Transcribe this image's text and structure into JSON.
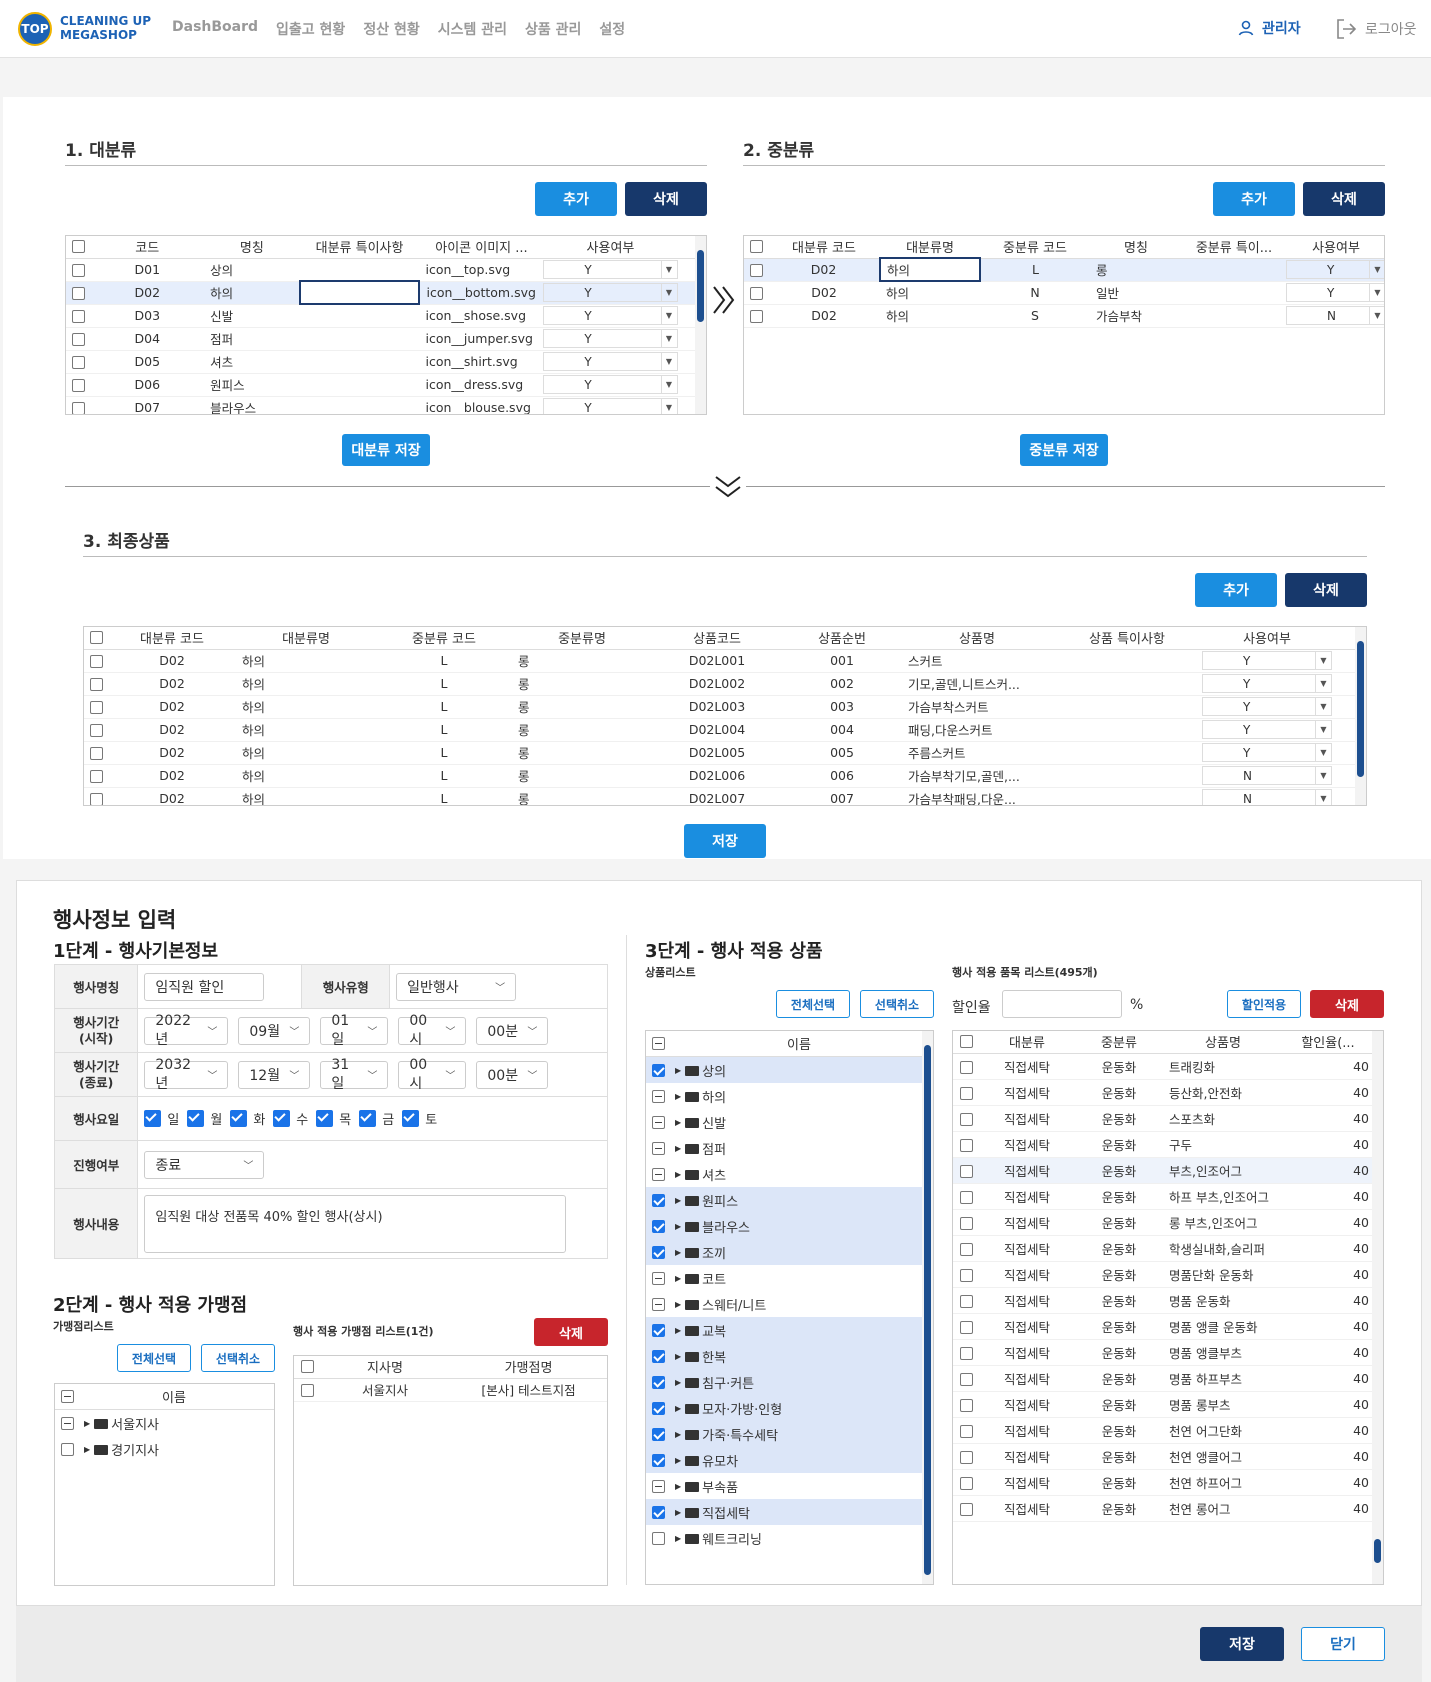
{
  "brand": {
    "logo": "TOP",
    "line1": "CLEANING UP",
    "line2": "MEGASHOP"
  },
  "nav": [
    "DashBoard",
    "입출고 현황",
    "정산 현황",
    "시스템 관리",
    "상품 관리",
    "설정"
  ],
  "user": {
    "name": "관리자",
    "logout": "로그아웃"
  },
  "buttons": {
    "add": "추가",
    "delete": "삭제",
    "save_major": "대분류 저장",
    "save_mid": "중분류 저장",
    "save": "저장",
    "close": "닫기",
    "select_all": "전체선택",
    "deselect": "선택취소",
    "apply_discount": "할인적용"
  },
  "major": {
    "title": "1. 대분류",
    "headers": [
      "코드",
      "명칭",
      "대분류 특이사항",
      "아이콘 이미지 ...",
      "사용여부"
    ],
    "rows": [
      {
        "code": "D01",
        "name": "상의",
        "icon": "icon__top.svg",
        "use": "Y"
      },
      {
        "code": "D02",
        "name": "하의",
        "icon": "icon__bottom.svg",
        "use": "Y"
      },
      {
        "code": "D03",
        "name": "신발",
        "icon": "icon__shose.svg",
        "use": "Y"
      },
      {
        "code": "D04",
        "name": "점퍼",
        "icon": "icon__jumper.svg",
        "use": "Y"
      },
      {
        "code": "D05",
        "name": "셔츠",
        "icon": "icon__shirt.svg",
        "use": "Y"
      },
      {
        "code": "D06",
        "name": "원피스",
        "icon": "icon__dress.svg",
        "use": "Y"
      },
      {
        "code": "D07",
        "name": "블라우스",
        "icon": "icon__blouse.svg",
        "use": "Y"
      }
    ]
  },
  "mid": {
    "title": "2. 중분류",
    "headers": [
      "대분류 코드",
      "대분류명",
      "중분류 코드",
      "명칭",
      "중분류 특이...",
      "사용여부"
    ],
    "rows": [
      {
        "mcode": "D02",
        "mname": "하의",
        "code": "L",
        "name": "롱",
        "use": "Y"
      },
      {
        "mcode": "D02",
        "mname": "하의",
        "code": "N",
        "name": "일반",
        "use": "Y"
      },
      {
        "mcode": "D02",
        "mname": "하의",
        "code": "S",
        "name": "가슴부착",
        "use": "N"
      }
    ]
  },
  "final": {
    "title": "3. 최종상품",
    "headers": [
      "대분류 코드",
      "대분류명",
      "중분류 코드",
      "중분류명",
      "상품코드",
      "상품순번",
      "상품명",
      "상품 특이사항",
      "사용여부"
    ],
    "rows": [
      {
        "mc": "D02",
        "mn": "하의",
        "sc": "L",
        "sn": "롱",
        "pc": "D02L001",
        "seq": "001",
        "pn": "스커트",
        "use": "Y"
      },
      {
        "mc": "D02",
        "mn": "하의",
        "sc": "L",
        "sn": "롱",
        "pc": "D02L002",
        "seq": "002",
        "pn": "기모,골덴,니트스커...",
        "use": "Y"
      },
      {
        "mc": "D02",
        "mn": "하의",
        "sc": "L",
        "sn": "롱",
        "pc": "D02L003",
        "seq": "003",
        "pn": "가슴부착스커트",
        "use": "Y"
      },
      {
        "mc": "D02",
        "mn": "하의",
        "sc": "L",
        "sn": "롱",
        "pc": "D02L004",
        "seq": "004",
        "pn": "패딩,다운스커트",
        "use": "Y"
      },
      {
        "mc": "D02",
        "mn": "하의",
        "sc": "L",
        "sn": "롱",
        "pc": "D02L005",
        "seq": "005",
        "pn": "주름스커트",
        "use": "Y"
      },
      {
        "mc": "D02",
        "mn": "하의",
        "sc": "L",
        "sn": "롱",
        "pc": "D02L006",
        "seq": "006",
        "pn": "가슴부착기모,골덴,...",
        "use": "N"
      },
      {
        "mc": "D02",
        "mn": "하의",
        "sc": "L",
        "sn": "롱",
        "pc": "D02L007",
        "seq": "007",
        "pn": "가슴부착패딩,다운...",
        "use": "N"
      }
    ]
  },
  "event": {
    "title": "행사정보 입력",
    "step1": "1단계 - 행사기본정보",
    "labels": {
      "name": "행사명칭",
      "type": "행사유형",
      "start": "행사기간\n(시작)",
      "end": "행사기간\n(종료)",
      "days": "행사요일",
      "status": "진행여부",
      "content": "행사내용"
    },
    "name_value": "임직원 할인",
    "type_value": "일반행사",
    "start": [
      "2022년",
      "09월",
      "01일",
      "00시",
      "00분"
    ],
    "end": [
      "2032년",
      "12월",
      "31일",
      "00시",
      "00분"
    ],
    "days": [
      "일",
      "월",
      "화",
      "수",
      "목",
      "금",
      "토"
    ],
    "status_value": "종료",
    "content_value": "임직원 대상 전품목 40% 할인 행사(상시)",
    "step2": "2단계 - 행사 적용 가맹점",
    "store_list_label": "가맹점리스트",
    "applied_store_label": "행사 적용 가맹점 리스트(1건)",
    "tree_header": "이름",
    "branches": [
      "서울지사",
      "경기지사"
    ],
    "store_headers": [
      "지사명",
      "가맹점명"
    ],
    "stores": [
      {
        "branch": "서울지사",
        "store": "[본사] 테스트지점"
      }
    ],
    "step3": "3단계 - 행사 적용 상품",
    "product_list_label": "상품리스트",
    "applied_product_label": "행사 적용 품목 리스트(495개)",
    "discount_label": "할인율",
    "percent": "%",
    "categories": [
      {
        "n": "상의",
        "s": "on"
      },
      {
        "n": "하의",
        "s": "ind"
      },
      {
        "n": "신발",
        "s": "ind"
      },
      {
        "n": "점퍼",
        "s": "ind"
      },
      {
        "n": "셔츠",
        "s": "ind"
      },
      {
        "n": "원피스",
        "s": "on"
      },
      {
        "n": "블라우스",
        "s": "on"
      },
      {
        "n": "조끼",
        "s": "on"
      },
      {
        "n": "코트",
        "s": "ind"
      },
      {
        "n": "스웨터/니트",
        "s": "ind"
      },
      {
        "n": "교복",
        "s": "on"
      },
      {
        "n": "한복",
        "s": "on"
      },
      {
        "n": "침구·커튼",
        "s": "on"
      },
      {
        "n": "모자·가방·인형",
        "s": "on"
      },
      {
        "n": "가죽·특수세탁",
        "s": "on"
      },
      {
        "n": "유모차",
        "s": "on"
      },
      {
        "n": "부속품",
        "s": "ind"
      },
      {
        "n": "직접세탁",
        "s": "on"
      },
      {
        "n": "웨트크리닝",
        "s": "off"
      }
    ],
    "item_headers": [
      "대분류",
      "중분류",
      "상품명",
      "할인율(..."
    ],
    "items": [
      [
        "직접세탁",
        "운동화",
        "트래킹화",
        "40"
      ],
      [
        "직접세탁",
        "운동화",
        "등산화,안전화",
        "40"
      ],
      [
        "직접세탁",
        "운동화",
        "스포츠화",
        "40"
      ],
      [
        "직접세탁",
        "운동화",
        "구두",
        "40"
      ],
      [
        "직접세탁",
        "운동화",
        "부츠,인조어그",
        "40"
      ],
      [
        "직접세탁",
        "운동화",
        "하프 부츠,인조어그",
        "40"
      ],
      [
        "직접세탁",
        "운동화",
        "롱 부츠,인조어그",
        "40"
      ],
      [
        "직접세탁",
        "운동화",
        "학생실내화,슬리퍼",
        "40"
      ],
      [
        "직접세탁",
        "운동화",
        "명품단화 운동화",
        "40"
      ],
      [
        "직접세탁",
        "운동화",
        "명품 운동화",
        "40"
      ],
      [
        "직접세탁",
        "운동화",
        "명품 앵클 운동화",
        "40"
      ],
      [
        "직접세탁",
        "운동화",
        "명품 앵클부츠",
        "40"
      ],
      [
        "직접세탁",
        "운동화",
        "명품 하프부츠",
        "40"
      ],
      [
        "직접세탁",
        "운동화",
        "명품 롱부츠",
        "40"
      ],
      [
        "직접세탁",
        "운동화",
        "천연 어그단화",
        "40"
      ],
      [
        "직접세탁",
        "운동화",
        "천연 앵클어그",
        "40"
      ],
      [
        "직접세탁",
        "운동화",
        "천연 하프어그",
        "40"
      ],
      [
        "직접세탁",
        "운동화",
        "천연 롱어그",
        "40"
      ]
    ]
  },
  "colors": {
    "primary": "#1a8ee0",
    "navy": "#17386b",
    "red": "#c7252c"
  }
}
